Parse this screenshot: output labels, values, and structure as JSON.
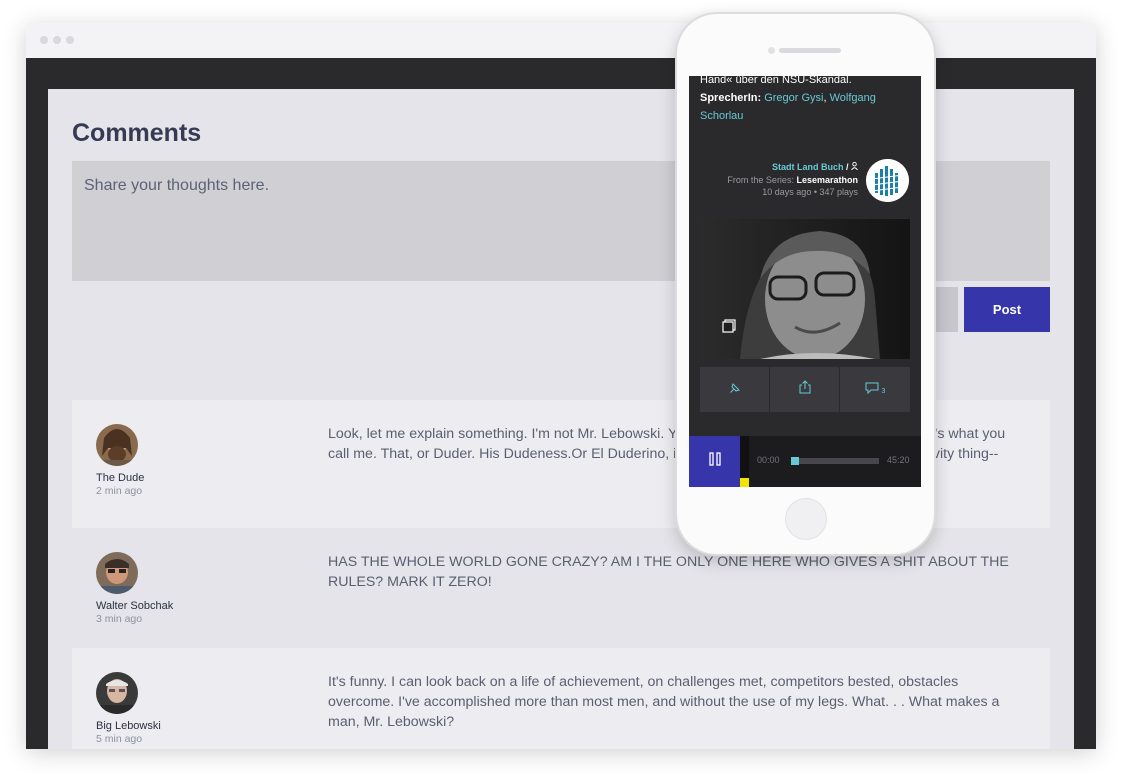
{
  "comments_section": {
    "title": "Comments",
    "input_placeholder": "Share your thoughts here.",
    "post_label": "Post"
  },
  "comments": [
    {
      "author": "The Dude",
      "time": "2 min ago",
      "text": "Look, let me explain something. I'm not Mr. Lebowski. You're Mr. Lebowski. I'm the Dude. So that's what you call me. That, or Duder. His Dudeness.Or El Duderino, if, you know, you're not into the whole brevity thing--"
    },
    {
      "author": "Walter Sobchak",
      "time": "3 min ago",
      "text": "HAS THE WHOLE WORLD GONE CRAZY? AM I THE ONLY ONE HERE WHO GIVES A SHIT ABOUT THE RULES? MARK IT ZERO!"
    },
    {
      "author": "Big Lebowski",
      "time": "5 min ago",
      "text": "It's funny. I can look back on a life of achievement, on challenges met, competitors bested, obstacles overcome. I've accomplished more than most men, and without the use of my legs. What. . . What makes a man, Mr. Lebowski?"
    }
  ],
  "phone": {
    "description_tail": "Hand« über den NSU-Skandal.",
    "speaker_label": "SprecherIn:",
    "speaker_1": "Gregor Gysi",
    "speaker_separator": ",",
    "speaker_2": "Wolfgang Schorlau",
    "channel_name": "Stadt Land Buch",
    "channel_separator": " / ",
    "series_prefix": "From the Series:",
    "series_name": "Lesemarathon",
    "posted": "10 days ago • 347 plays",
    "comment_count": "3",
    "time_elapsed": "00:00",
    "time_total": "45:20",
    "progress": 0.0
  },
  "colors": {
    "accent": "#3636aa",
    "link": "#67c9d6",
    "marker": "#f2e300"
  }
}
